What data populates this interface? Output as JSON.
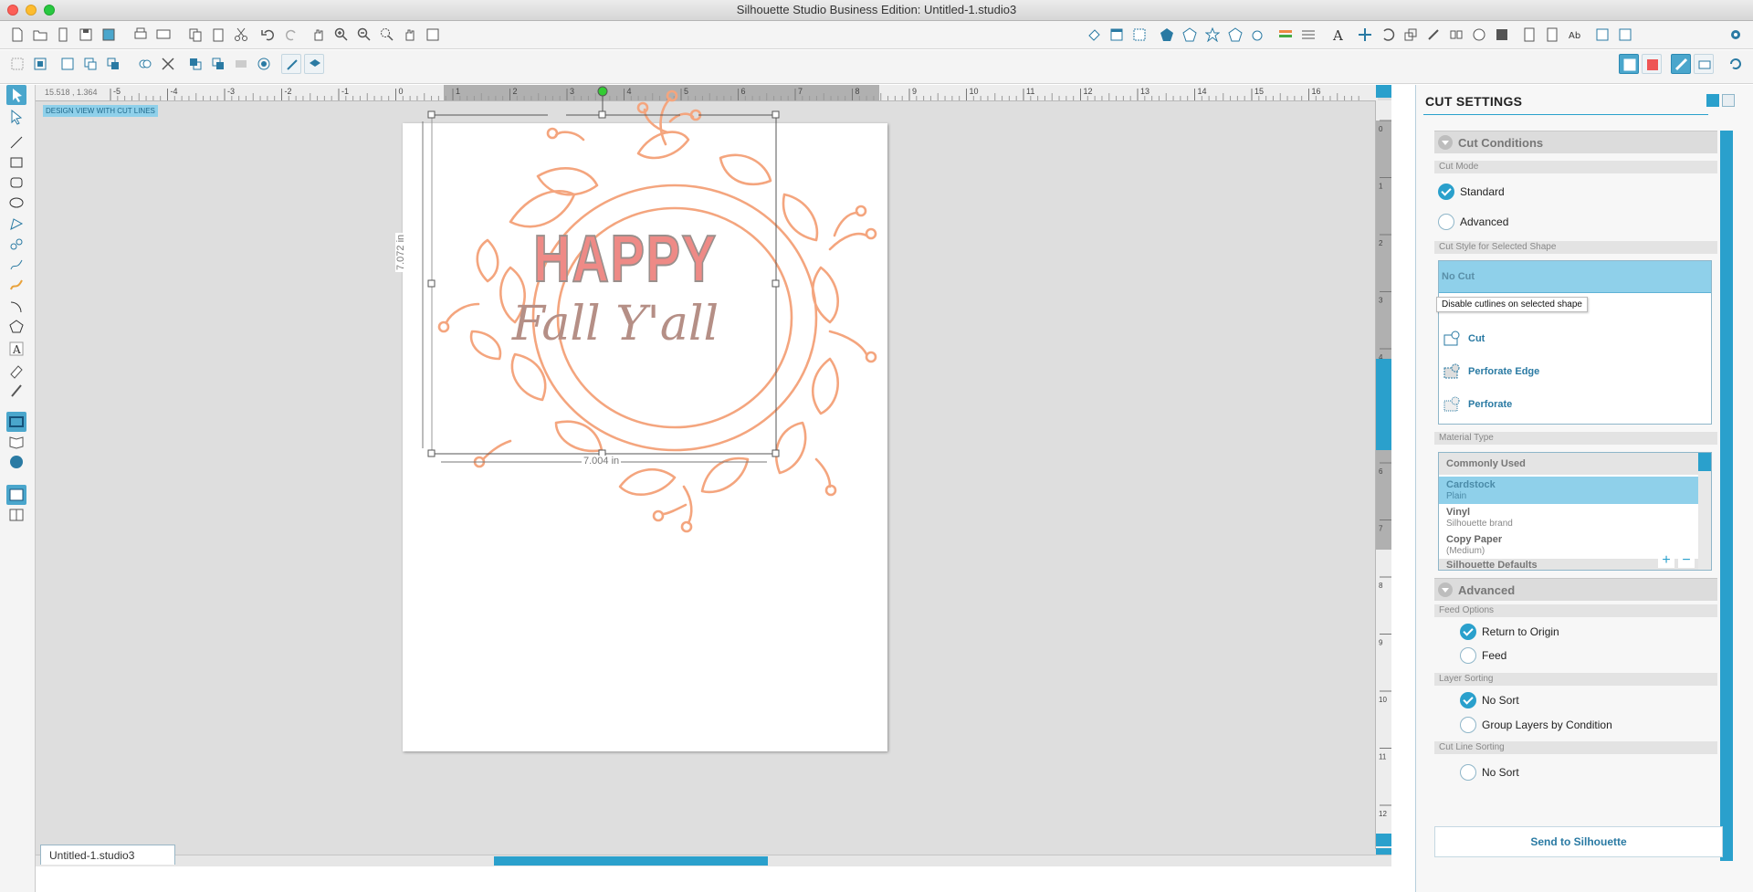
{
  "window": {
    "title": "Silhouette Studio Business Edition: Untitled-1.studio3"
  },
  "canvas": {
    "coordinates": "15.518 , 1.364",
    "view_label": "DESIGN VIEW WITH CUT LINES",
    "ruler_ticks": [
      "-5",
      "-4",
      "-3",
      "-2",
      "-1",
      "0",
      "1",
      "2",
      "3",
      "4",
      "5",
      "6",
      "7",
      "8",
      "9",
      "10",
      "11",
      "12",
      "13",
      "14",
      "15",
      "16"
    ],
    "vruler_ticks": [
      "0",
      "1",
      "2",
      "3",
      "4",
      "5",
      "6",
      "7",
      "8",
      "9",
      "10",
      "11",
      "12"
    ],
    "artwork": {
      "headline": "HAPPY",
      "tagline": "Fall Y'all"
    },
    "dims": {
      "height": "7.072 in",
      "width": "7.004 in"
    },
    "doc_tab": "Untitled-1.studio3"
  },
  "panel": {
    "title": "CUT SETTINGS",
    "cut_conditions": {
      "header": "Cut Conditions",
      "cut_mode_label": "Cut Mode",
      "modes": [
        {
          "label": "Standard",
          "selected": true
        },
        {
          "label": "Advanced",
          "selected": false
        }
      ],
      "cut_style_label": "Cut Style for Selected Shape",
      "styles": {
        "no_cut": "No Cut",
        "cut": "Cut",
        "perforate_edge": "Perforate Edge",
        "perforate": "Perforate"
      },
      "tooltip": "Disable cutlines on selected shape"
    },
    "material": {
      "label": "Material Type",
      "commonly_used": "Commonly Used",
      "items": [
        {
          "name": "Cardstock",
          "sub": "Plain",
          "selected": true
        },
        {
          "name": "Vinyl",
          "sub": "Silhouette brand",
          "selected": false
        },
        {
          "name": "Copy Paper",
          "sub": "(Medium)",
          "selected": false
        }
      ],
      "defaults": "Silhouette Defaults"
    },
    "advanced": {
      "header": "Advanced",
      "feed_label": "Feed Options",
      "feed": [
        {
          "label": "Return to Origin",
          "selected": true
        },
        {
          "label": "Feed",
          "selected": false
        }
      ],
      "layer_label": "Layer Sorting",
      "layer": [
        {
          "label": "No Sort",
          "selected": true
        },
        {
          "label": "Group Layers by Condition",
          "selected": false
        }
      ],
      "cutline_label": "Cut Line Sorting",
      "cutline": [
        {
          "label": "No Sort",
          "selected": false
        }
      ]
    },
    "send_button": "Send to Silhouette"
  },
  "colors": {
    "accent": "#2aa0cc",
    "wreath": "#f4a57e",
    "headline": "#ee8a86",
    "tagline": "#b58f86"
  }
}
